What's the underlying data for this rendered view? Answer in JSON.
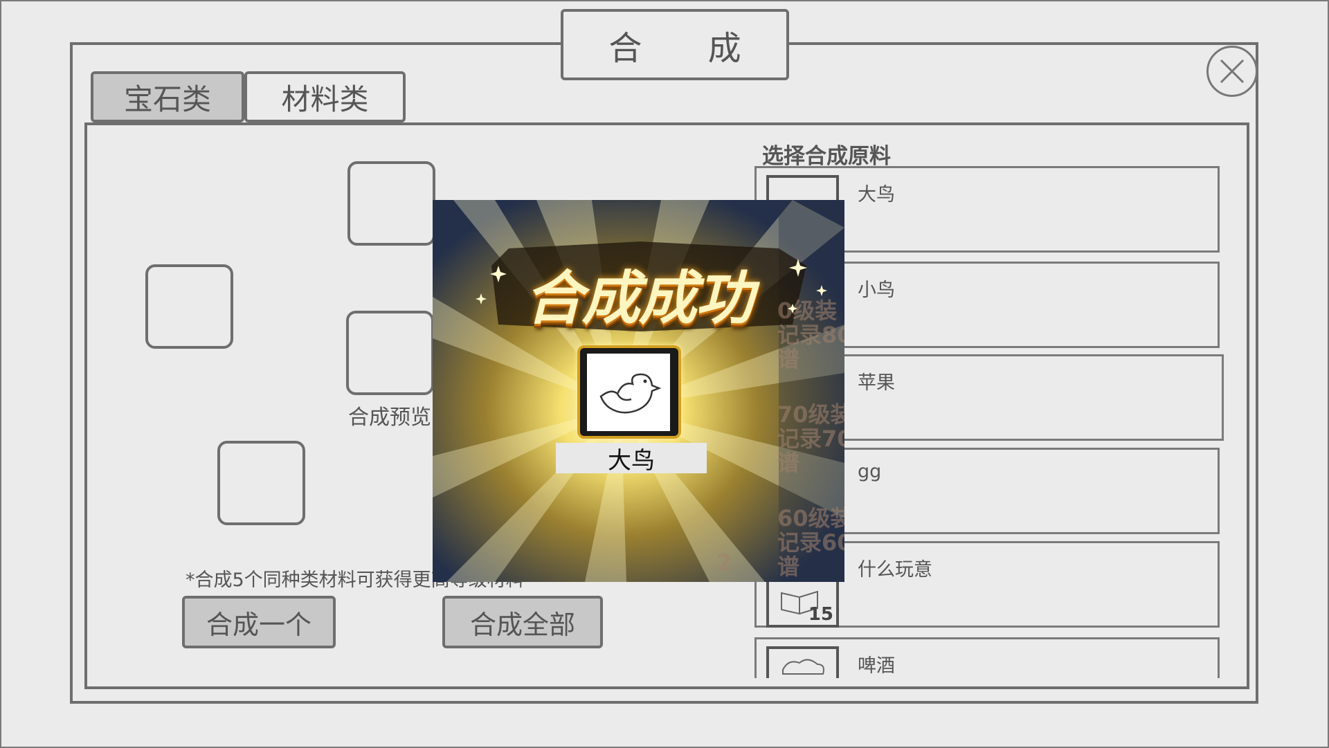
{
  "window": {
    "title": "合 成"
  },
  "tabs": [
    {
      "label": "宝石类",
      "active": true
    },
    {
      "label": "材料类",
      "active": false
    }
  ],
  "synth_area": {
    "preview_label": "合成预览",
    "hint": "*合成5个同种类材料可获得更高等级材料",
    "buttons": {
      "one": "合成一个",
      "all": "合成全部"
    }
  },
  "material_list": {
    "title": "选择合成原料",
    "items": [
      {
        "name": "大鸟",
        "count": ""
      },
      {
        "name": "小鸟",
        "count": ""
      },
      {
        "name": "苹果",
        "count": ""
      },
      {
        "name": "gg",
        "count": ""
      },
      {
        "name": "什么玩意",
        "count": "15"
      },
      {
        "name": "啤酒",
        "count": ""
      }
    ]
  },
  "popup": {
    "title": "合成成功",
    "item_name": "大鸟",
    "item_icon": "bird-icon",
    "background_text": [
      "0级装",
      "记录80",
      "谱",
      "70级装",
      "记录70",
      "谱",
      "60级装",
      "记录60",
      "谱",
      "2"
    ]
  },
  "colors": {
    "panel_border": "#6e6e6e",
    "button_fill": "#c8c8c8",
    "background": "#ebebeb",
    "popup_title": "#fff5c0"
  }
}
